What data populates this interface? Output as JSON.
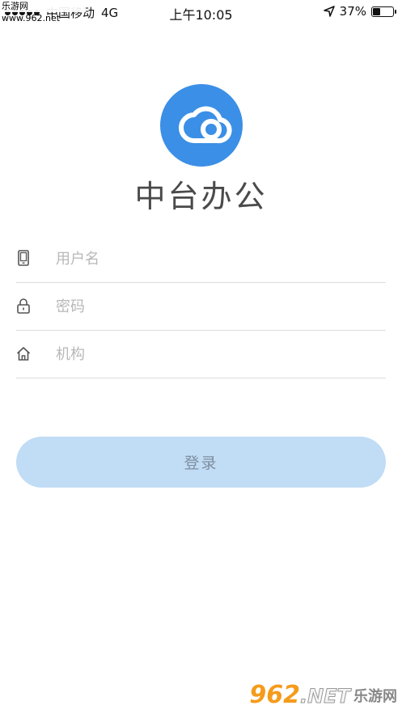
{
  "status_bar": {
    "carrier": "中国移动",
    "network": "4G",
    "time": "上午10:05",
    "battery": "37%",
    "battery_level": 0.37
  },
  "watermark": {
    "top_text": "乐游网 www.962.net",
    "bottom_number": "962",
    "bottom_suffix": ".NET",
    "bottom_text": "乐游网"
  },
  "app": {
    "title": "中台办公"
  },
  "form": {
    "username_placeholder": "用户名",
    "password_placeholder": "密码",
    "org_placeholder": "机构",
    "login_label": "登录"
  },
  "icons": {
    "logo": "cloud-logo-icon",
    "username": "phone-icon",
    "password": "lock-icon",
    "org": "home-icon",
    "location": "location-arrow-icon",
    "battery": "battery-icon"
  },
  "colors": {
    "logo_bg": "#3b8fe6",
    "button_bg": "#c1dcf5",
    "button_text": "#7f8ea0"
  }
}
